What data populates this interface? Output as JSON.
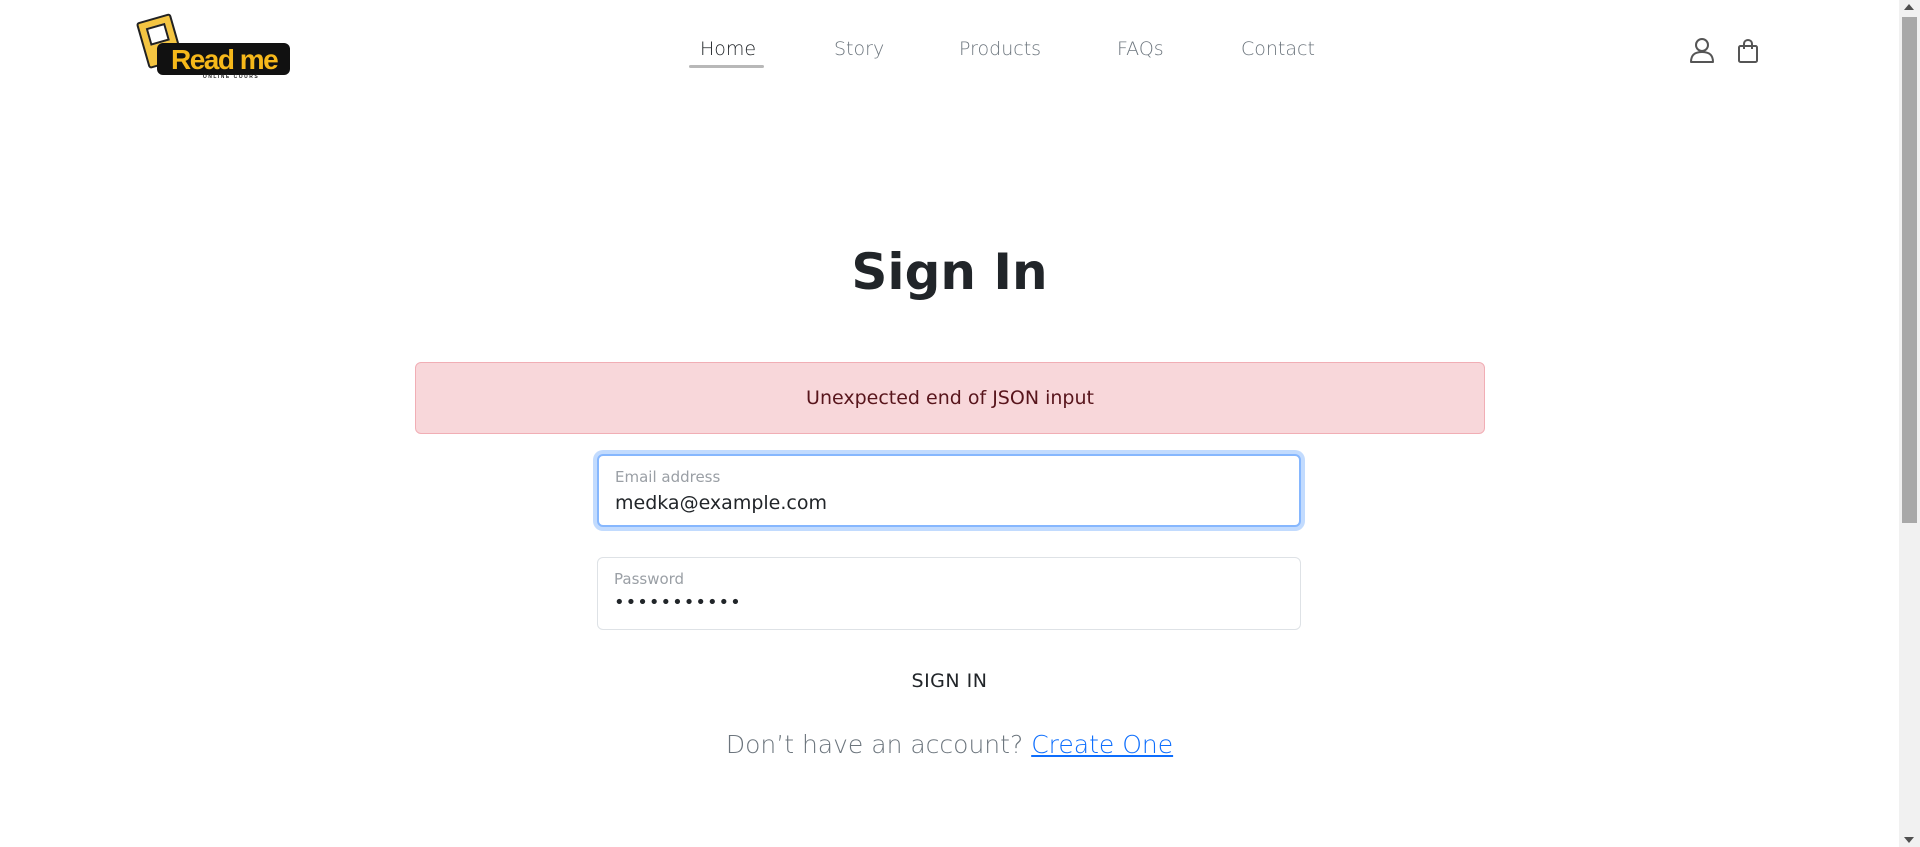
{
  "brand": {
    "logo_text": "Read me",
    "logo_subtext": "ONLINE COURS",
    "logo_color": "#f6b81a"
  },
  "nav": {
    "items": [
      {
        "label": "Home",
        "active": true
      },
      {
        "label": "Story",
        "active": false
      },
      {
        "label": "Products",
        "active": false
      },
      {
        "label": "FAQs",
        "active": false
      },
      {
        "label": "Contact",
        "active": false
      }
    ],
    "icons": [
      "user-icon",
      "shopping-bag-icon"
    ]
  },
  "main": {
    "title": "Sign In",
    "alert": "Unexpected end of JSON input",
    "email": {
      "label": "Email address",
      "value": "medka@example.com"
    },
    "password": {
      "label": "Password",
      "value": "•••••••••••"
    },
    "submit_label": "SIGN IN",
    "signup_prompt": "Don’t have an account?",
    "signup_link": "Create One"
  },
  "colors": {
    "alert_bg": "#f8d7da",
    "link": "#0d6efd",
    "focus_ring": "#86b7fe"
  }
}
